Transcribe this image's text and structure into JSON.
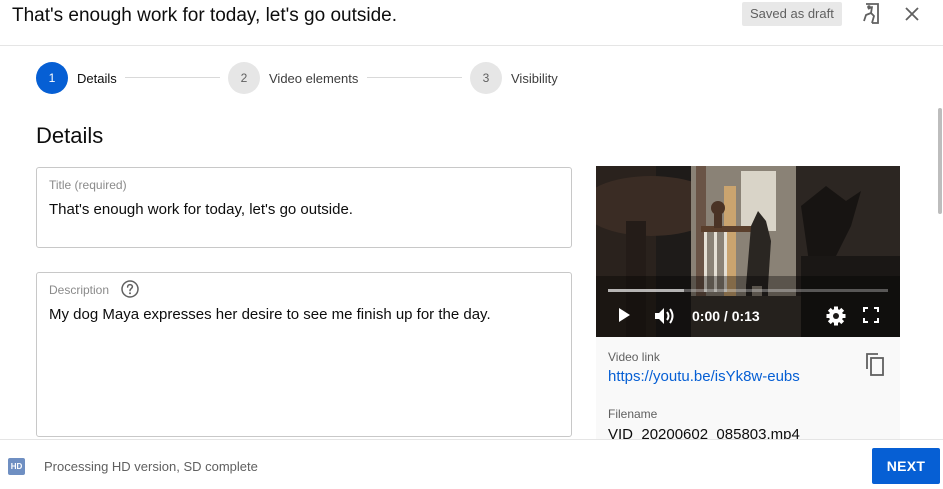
{
  "header": {
    "title": "That's enough work for today, let's go outside.",
    "draft_status": "Saved as draft",
    "feedback_icon": "feedback-icon",
    "close_icon": "close-icon"
  },
  "stepper": {
    "steps": [
      {
        "number": "1",
        "label": "Details",
        "active": true
      },
      {
        "number": "2",
        "label": "Video elements",
        "active": false
      },
      {
        "number": "3",
        "label": "Visibility",
        "active": false
      }
    ]
  },
  "section": {
    "heading": "Details"
  },
  "title_field": {
    "label": "Title (required)",
    "value": "That's enough work for today, let's go outside."
  },
  "description_field": {
    "label": "Description",
    "value": "My dog Maya expresses her desire to see me finish up for the day.",
    "help_icon": "help-icon"
  },
  "video": {
    "time": "0:00 / 0:13",
    "buffered_fraction": 0.27,
    "link_label": "Video link",
    "link": "https://youtu.be/isYk8w-eubs",
    "filename_label": "Filename",
    "filename": "VID_20200602_085803.mp4"
  },
  "footer": {
    "badge": "HD",
    "status": "Processing HD version, SD complete",
    "next_label": "NEXT"
  },
  "colors": {
    "accent": "#065fd4",
    "step_inactive": "#e6e6e6",
    "draft_badge_bg": "#e8e8e8",
    "hd_badge": "#6f8fc2"
  }
}
